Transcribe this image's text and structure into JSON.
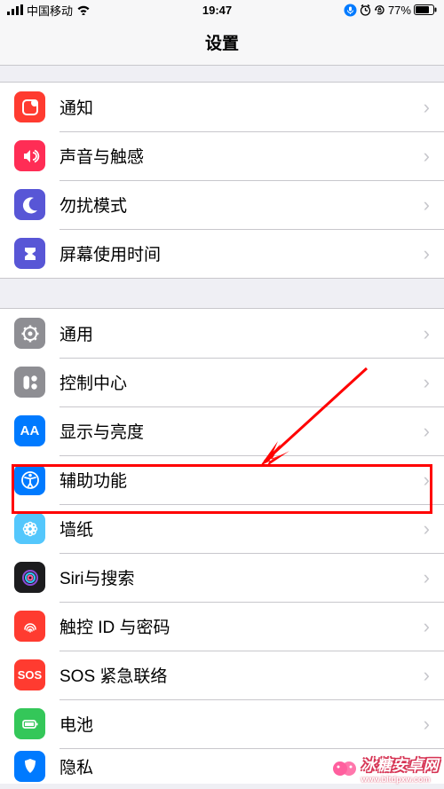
{
  "status": {
    "carrier": "中国移动",
    "time": "19:47",
    "battery": "77%"
  },
  "header": {
    "title": "设置"
  },
  "group1": [
    {
      "label": "通知",
      "icon": "notifications",
      "bg": "#ff3b30"
    },
    {
      "label": "声音与触感",
      "icon": "sounds",
      "bg": "#ff2d55"
    },
    {
      "label": "勿扰模式",
      "icon": "dnd",
      "bg": "#5856d6"
    },
    {
      "label": "屏幕使用时间",
      "icon": "screentime",
      "bg": "#5856d6"
    }
  ],
  "group2": [
    {
      "label": "通用",
      "icon": "general",
      "bg": "#8e8e93"
    },
    {
      "label": "控制中心",
      "icon": "control",
      "bg": "#8e8e93"
    },
    {
      "label": "显示与亮度",
      "icon": "display",
      "bg": "#007aff"
    },
    {
      "label": "辅助功能",
      "icon": "accessibility",
      "bg": "#007aff"
    },
    {
      "label": "墙纸",
      "icon": "wallpaper",
      "bg": "#54c7fc"
    },
    {
      "label": "Siri与搜索",
      "icon": "siri",
      "bg": "#1c1c1e"
    },
    {
      "label": "触控 ID 与密码",
      "icon": "touchid",
      "bg": "#ff3b30"
    },
    {
      "label": "SOS 紧急联络",
      "icon": "sos",
      "bg": "#ff3b30",
      "text": "SOS"
    },
    {
      "label": "电池",
      "icon": "battery",
      "bg": "#34c759"
    },
    {
      "label": "隐私",
      "icon": "privacy",
      "bg": "#007aff"
    }
  ],
  "watermark": {
    "text": "冰糖安卓网",
    "url": "www.bltdpxw.com"
  }
}
